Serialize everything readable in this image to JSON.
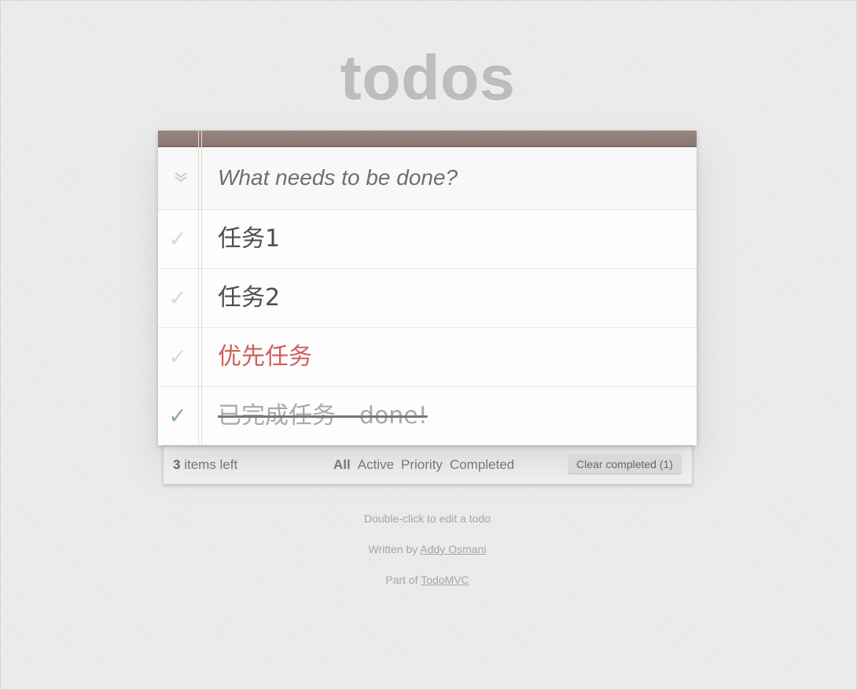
{
  "app": {
    "title": "todos"
  },
  "new_todo": {
    "placeholder": "What needs to be done?"
  },
  "todos": [
    {
      "title": "任务1",
      "completed": false,
      "priority": false
    },
    {
      "title": "任务2",
      "completed": false,
      "priority": false
    },
    {
      "title": "优先任务",
      "completed": false,
      "priority": true
    },
    {
      "title": "已完成任务 - done!",
      "completed": true,
      "priority": false
    }
  ],
  "footer": {
    "count": "3",
    "count_suffix": " items left",
    "filters": [
      "All",
      "Active",
      "Priority",
      "Completed"
    ],
    "selected_filter": "All",
    "clear_completed": "Clear completed (1)"
  },
  "info": {
    "edit_hint": "Double-click to edit a todo",
    "written_by_prefix": "Written by ",
    "author": "Addy Osmani",
    "part_of_prefix": "Part of ",
    "project": "TodoMVC"
  },
  "colors": {
    "header": "#8a7571",
    "priority_text": "#d0605a",
    "done_check": "#85ada7"
  },
  "icons": {
    "toggle_all": "double-chevron-down-icon",
    "toggle": "checkmark-icon"
  }
}
